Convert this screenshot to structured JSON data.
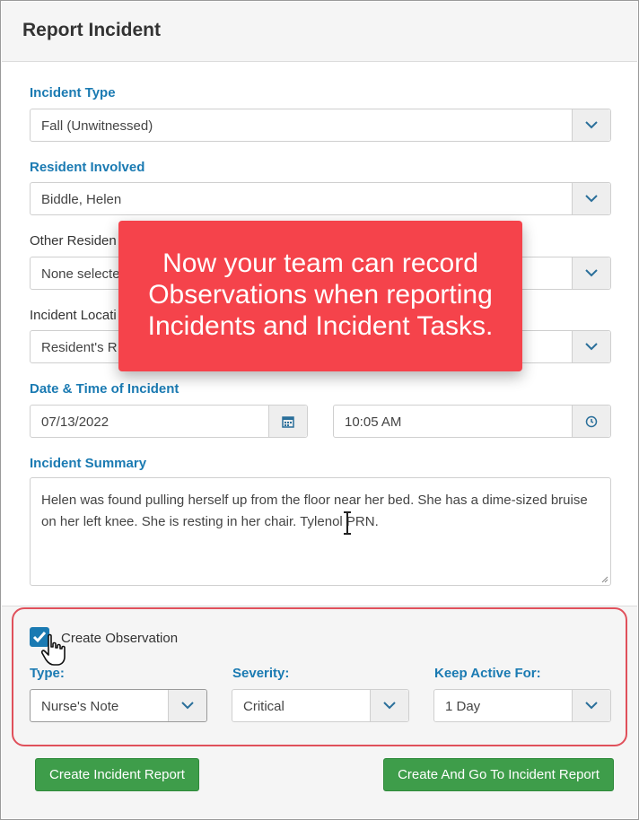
{
  "header": {
    "title": "Report Incident"
  },
  "incident_type": {
    "label": "Incident Type",
    "value": "Fall (Unwitnessed)"
  },
  "resident": {
    "label": "Resident Involved",
    "value": "Biddle, Helen"
  },
  "other_residents": {
    "label": "Other Residen",
    "value": "None selecte"
  },
  "location": {
    "label": "Incident Locati",
    "value": "Resident's R"
  },
  "datetime": {
    "label": "Date & Time of Incident",
    "date": "07/13/2022",
    "time": "10:05 AM"
  },
  "summary": {
    "label": "Incident Summary",
    "text": "Helen was found pulling herself up from the floor near her bed. She has a dime-sized bruise on her left knee. She is resting in her chair. Tylenol PRN."
  },
  "callout": {
    "lines": [
      "Now your team can record",
      "Observations when reporting",
      "Incidents and Incident Tasks."
    ]
  },
  "observation": {
    "checkbox_label": "Create Observation",
    "checked": true,
    "type": {
      "label": "Type:",
      "value": "Nurse's Note"
    },
    "severity": {
      "label": "Severity:",
      "value": "Critical"
    },
    "keep_active": {
      "label": "Keep Active For:",
      "value": "1 Day"
    }
  },
  "buttons": {
    "create": "Create Incident Report",
    "create_go": "Create And Go To Incident Report"
  },
  "colors": {
    "accent": "#1a7ab2",
    "callout": "#f5434b",
    "button": "#3e9d4a",
    "highlight": "#e0505b"
  }
}
